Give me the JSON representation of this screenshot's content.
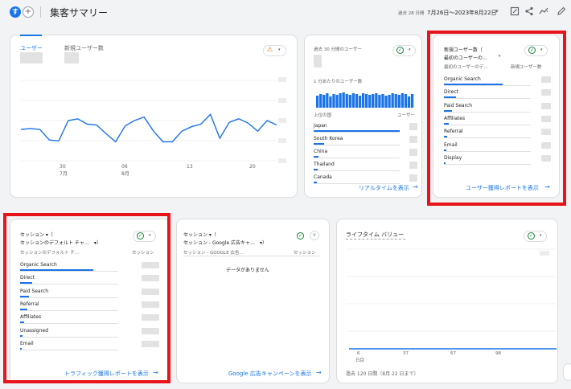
{
  "header": {
    "logo_letter": "す",
    "add_symbol": "+",
    "title": "集客サマリー",
    "period_label": "過去 28 日間",
    "date_range": "7月26日～2023年8月22日",
    "caret": "▾",
    "icons": [
      "edit-report-icon",
      "share-icon",
      "insights-icon",
      "pencil-icon"
    ]
  },
  "users_card": {
    "tab_users": "ユーザー",
    "tab_new_users": "新規ユーザー数",
    "warning_symbol": "⚠",
    "x_ticks": [
      {
        "day": "30",
        "month": "7月"
      },
      {
        "day": "06",
        "month": "8月"
      },
      {
        "day": "13",
        "month": ""
      },
      {
        "day": "20",
        "month": ""
      }
    ],
    "chart_data": {
      "type": "line",
      "title": "",
      "xlabel": "",
      "ylabel": "",
      "x": [
        "7/26",
        "7/27",
        "7/28",
        "7/29",
        "7/30",
        "7/31",
        "8/1",
        "8/2",
        "8/3",
        "8/4",
        "8/5",
        "8/6",
        "8/7",
        "8/8",
        "8/9",
        "8/10",
        "8/11",
        "8/12",
        "8/13",
        "8/14",
        "8/15",
        "8/16",
        "8/17",
        "8/18",
        "8/19",
        "8/20",
        "8/21",
        "8/22"
      ],
      "ylim": [
        0,
        100
      ],
      "series": [
        {
          "values": [
            40,
            41,
            40,
            28,
            27,
            50,
            52,
            46,
            45,
            35,
            26,
            44,
            50,
            54,
            38,
            26,
            26,
            38,
            43,
            46,
            57,
            30,
            48,
            52,
            47,
            38,
            50,
            45
          ]
        }
      ],
      "grid": true,
      "color": "#1a73e8"
    }
  },
  "realtime_card": {
    "title": "過去 30 分間のユーザー",
    "per_minute": "1 分あたりのユーザー数",
    "col_country": "上位の国",
    "col_users": "ユーザー",
    "countries": [
      "Japan",
      "South Korea",
      "China",
      "Thailand",
      "Canada"
    ],
    "country_share": [
      1.0,
      0.12,
      0.06,
      0.05,
      0.04
    ],
    "minute_bars": [
      0.75,
      0.85,
      0.8,
      0.9,
      0.7,
      0.85,
      0.8,
      0.9,
      0.95,
      0.85,
      0.8,
      0.9,
      0.85,
      0.75,
      0.9,
      0.85,
      0.8,
      0.85,
      0.9,
      0.8,
      0.85,
      0.75,
      0.8,
      0.9,
      0.85,
      0.8,
      0.9,
      0.85,
      0.7,
      0.85
    ],
    "link": "リアルタイムを表示",
    "arrow": "→"
  },
  "new_users_card": {
    "title_line1": "新規ユーザー数（",
    "title_line2": "最初のユーザーの…",
    "col_dim": "最初のユーザーのデ…",
    "col_metric": "新規ユーザー数",
    "rows": [
      "Organic Search",
      "Direct",
      "Paid Search",
      "Affiliates",
      "Referral",
      "Email",
      "Display"
    ],
    "shares": [
      1.0,
      0.2,
      0.14,
      0.08,
      0.05,
      0.04,
      0.02
    ],
    "link": "ユーザー獲得レポートを表示",
    "arrow": "→"
  },
  "sessions_card": {
    "title_line1": "セッション ▾（",
    "title_line2": "セッションのデフォルト チャ…　▾）",
    "col_dim": "セッションのデフォルト チ…",
    "col_metric": "セッション",
    "rows": [
      "Organic Search",
      "Direct",
      "Paid Search",
      "Referral",
      "Affiliates",
      "Unassigned",
      "Email"
    ],
    "shares": [
      1.0,
      0.17,
      0.12,
      0.1,
      0.05,
      0.03,
      0.02
    ],
    "link": "トラフィック獲得レポートを表示",
    "arrow": "→"
  },
  "google_ads_card": {
    "title_line1": "セッション ▾（",
    "title_line2": "セッション - Google 広告キャ…　▾）",
    "col_dim": "セッション - GOOGLE 広告…",
    "col_metric": "セッション",
    "empty": "データがありません",
    "link": "Google 広告キャンペーンを表示",
    "arrow": "→"
  },
  "lifetime_card": {
    "title": "ライフタイム バリュー",
    "x_ticks": [
      {
        "value": "6",
        "unit": "日目"
      },
      {
        "value": "37",
        "unit": ""
      },
      {
        "value": "67",
        "unit": ""
      },
      {
        "value": "98",
        "unit": ""
      }
    ],
    "footer": "過去 120 日間（8月 22 日まで）"
  },
  "colors": {
    "accent": "#1a73e8",
    "highlight": "#e8141b",
    "ok": "#188038",
    "warn": "#e37400"
  }
}
